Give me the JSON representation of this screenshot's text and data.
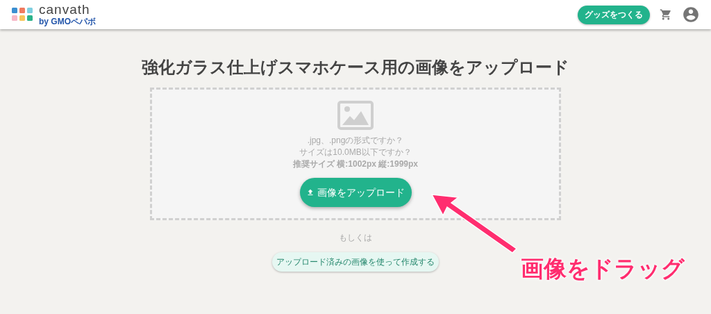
{
  "header": {
    "logo_text": "canvath",
    "logo_byline": "by GMOペパボ",
    "make_goods_button": "グッズをつくる"
  },
  "title": "強化ガラス仕上げスマホケース用の画像をアップロード",
  "dropzone": {
    "hints": [
      ".jpg、.pngの形式ですか？",
      "サイズは10.0MB以下ですか？"
    ],
    "recommended": "推奨サイズ 横:1002px 縦:1999px",
    "upload_button": "画像をアップロード"
  },
  "or_text": "もしくは",
  "uploaded_button": "アップロード済みの画像を使って作成する",
  "annotation": "画像をドラッグ"
}
